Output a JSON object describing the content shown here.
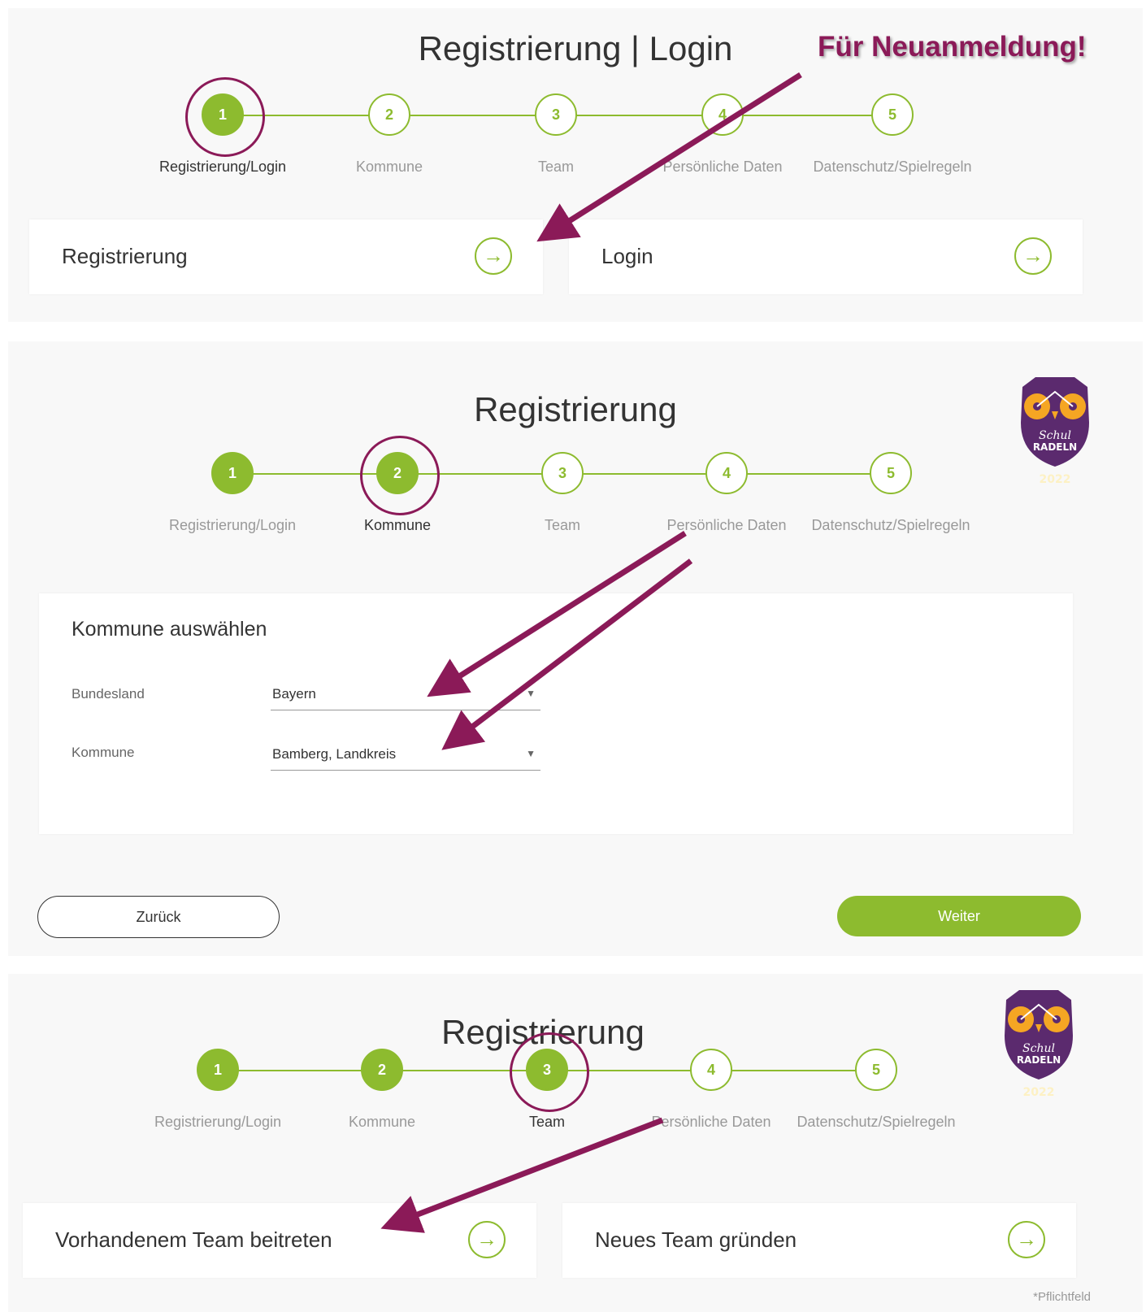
{
  "colors": {
    "accent": "#8dbb2f",
    "annotation": "#8b1a58",
    "text": "#333333",
    "muted": "#999999"
  },
  "annotation_text": "Für Neuanmeldung!",
  "steps": [
    "Registrierung/Login",
    "Kommune",
    "Team",
    "Persönliche Daten",
    "Datenschutz/Spielregeln"
  ],
  "step_numbers": [
    "1",
    "2",
    "3",
    "4",
    "5"
  ],
  "panel1": {
    "title": "Registrierung | Login",
    "active_step": 1,
    "cards": {
      "register": "Registrierung",
      "login": "Login"
    }
  },
  "panel2": {
    "title": "Registrierung",
    "active_step": 2,
    "section_title": "Kommune auswählen",
    "fields": {
      "state_label": "Bundesland",
      "state_value": "Bayern",
      "kommune_label": "Kommune",
      "kommune_value": "Bamberg, Landkreis"
    },
    "back_label": "Zurück",
    "next_label": "Weiter",
    "logo": {
      "line1": "Schul",
      "line2": "RADELN",
      "year": "2022"
    }
  },
  "panel3": {
    "title": "Registrierung",
    "active_step": 3,
    "cards": {
      "join": "Vorhandenem Team beitreten",
      "new": "Neues Team gründen"
    },
    "required_note": "*Pflichtfeld",
    "logo": {
      "line1": "Schul",
      "line2": "RADELN",
      "year": "2022"
    }
  },
  "icons": {
    "go": "arrow-right-circle-icon",
    "caret": "caret-down-icon",
    "logo": "owl-bicycle-logo"
  }
}
